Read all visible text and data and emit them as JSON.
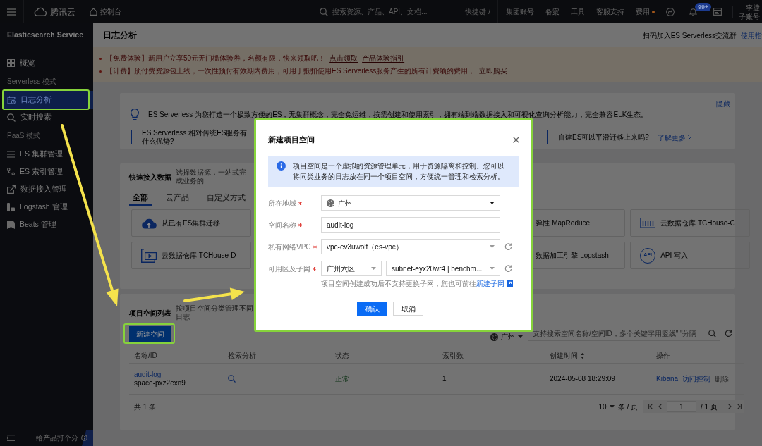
{
  "top_bar": {
    "logo": "腾讯云",
    "console_link": "控制台",
    "search": {
      "placeholder": "搜索资源、产品、API、文档..."
    },
    "shortcut": "快捷键 /",
    "links": [
      {
        "label": "集团账号",
        "dot": false
      },
      {
        "label": "备案",
        "dot": false
      },
      {
        "label": "工具",
        "dot": false
      },
      {
        "label": "客服支持",
        "dot": false
      },
      {
        "label": "费用",
        "dot": true
      }
    ],
    "notification_badge": "99+",
    "account": {
      "name": "李捷",
      "type": "子账号"
    }
  },
  "sidebar": {
    "title": "Elasticsearch Service",
    "items": [
      {
        "kind": "item",
        "label": "概览",
        "selected": false,
        "highlighted": false
      },
      {
        "kind": "section",
        "label": "Serverless 模式"
      },
      {
        "kind": "item",
        "label": "日志分析",
        "selected": true,
        "highlighted": true
      },
      {
        "kind": "item",
        "label": "实时搜索",
        "selected": false,
        "highlighted": false
      },
      {
        "kind": "section",
        "label": "PaaS 模式"
      },
      {
        "kind": "item",
        "label": "ES 集群管理",
        "selected": false,
        "highlighted": false
      },
      {
        "kind": "item",
        "label": "ES 索引管理",
        "selected": false,
        "highlighted": false
      },
      {
        "kind": "item",
        "label": "数据接入管理",
        "selected": false,
        "highlighted": false
      },
      {
        "kind": "item",
        "label": "Logstash 管理",
        "selected": false,
        "highlighted": false
      },
      {
        "kind": "item",
        "label": "Beats 管理",
        "selected": false,
        "highlighted": false
      }
    ],
    "feedback_link": "给产品打个分"
  },
  "header": {
    "title": "日志分析",
    "community": "扫码加入ES Serverless交流群",
    "guide_link": "使用指"
  },
  "notices": [
    {
      "text": "【免费体验】新用户立享50元无门槛体验券，名额有限，快来领取吧！",
      "links": [
        "点击领取",
        "产品体验指引"
      ]
    },
    {
      "text": "【计费】预付费资源包上线，一次性预付有效期内费用，可用于抵扣使用ES Serverless服务产生的所有计费项的费用，",
      "links": [
        "立即购买"
      ]
    }
  ],
  "intro": {
    "headline": "ES Serverless 为您打造一个极致方便的ES，无集群概念，完全免运维，按需创建和使用索引，拥有端到端数据接入和可视化查询分析能力，完全兼容ELK生态。",
    "hide_link": "隐藏",
    "faqs": [
      {
        "question": "ES Serverless 相对传统ES服务有什么优势?"
      },
      {
        "question": "自建ES可以平滑迁移上来吗?",
        "link": "了解更多"
      }
    ]
  },
  "quick_access": {
    "title": "快速接入数据",
    "subtitle": "选择数据源，一站式完成业务的",
    "tabs": [
      {
        "label": "全部",
        "selected": true
      },
      {
        "label": "云产品",
        "selected": false
      },
      {
        "label": "自定义方式",
        "selected": false
      }
    ],
    "sources": [
      {
        "label": "从已有ES集群迁移"
      },
      {
        "label": "弹性 MapReduce"
      },
      {
        "label": "云数据仓库 TCHouse-C"
      },
      {
        "label": "云数据仓库 TCHouse-D"
      },
      {
        "label": "数据加工引擎 Logstash"
      },
      {
        "label": "API 写入",
        "icon_text": "API"
      }
    ]
  },
  "project_spaces": {
    "title": "项目空间列表",
    "subtitle": "按项目空间分类管理不同日志",
    "create_button": {
      "label": "新建空间",
      "highlighted": true
    },
    "region": "广州",
    "search": {
      "placeholder": "支持搜索空间名称/空间ID，多个关键字用竖线\"|\"分隔"
    },
    "table": {
      "columns": [
        {
          "label": "名称/ID",
          "sortable": false
        },
        {
          "label": "检索分析",
          "sortable": false
        },
        {
          "label": "状态",
          "sortable": false
        },
        {
          "label": "索引数",
          "sortable": false
        },
        {
          "label": "创建时间",
          "sortable": true
        },
        {
          "label": "操作",
          "sortable": false
        }
      ],
      "rows": [
        {
          "name": "audit-log",
          "id": "space-pxz2exn9",
          "status": "正常",
          "index_count": "1",
          "created": "2024-05-08 18:29:09",
          "actions": [
            {
              "label": "Kibana",
              "disabled": false
            },
            {
              "label": "访问控制",
              "disabled": false
            },
            {
              "label": "删除",
              "disabled": true
            }
          ]
        }
      ]
    },
    "pagination": {
      "total": "共 1 条",
      "page_size": "10",
      "page_size_unit": "条 / 页",
      "page": "1",
      "page_count": "/ 1 页"
    }
  },
  "dialog": {
    "title": "新建项目空间",
    "highlighted": true,
    "info": "项目空间是一个虚拟的资源管理单元，用于资源隔离和控制。您可以将同类业务的日志放在同一个项目空间，方便统一管理和检索分析。",
    "fields": [
      {
        "kind": "region",
        "label": "所在地域",
        "required": true,
        "value": "广州"
      },
      {
        "kind": "text",
        "label": "空间名称",
        "required": true,
        "value": "audit-log"
      },
      {
        "kind": "vpc",
        "label": "私有网络VPC",
        "required": true,
        "value": "vpc-ev3uwolf（es-vpc）"
      },
      {
        "kind": "zone_subnet",
        "label": "可用区及子网",
        "required": true,
        "values": [
          "广州六区",
          "subnet-eyx20wr4 | benchm..."
        ],
        "hint": "项目空间创建成功后不支持更换子网，您也可前往",
        "hint_link": "新建子网"
      }
    ],
    "buttons": [
      {
        "label": "确认",
        "kind": "primary"
      },
      {
        "label": "取消",
        "kind": "default"
      }
    ]
  }
}
